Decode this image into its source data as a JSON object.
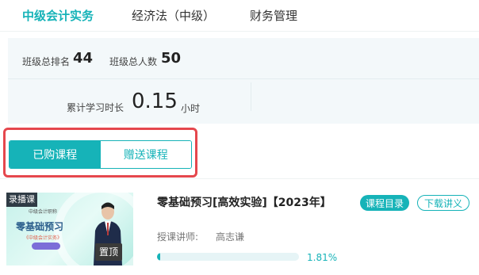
{
  "tabs": [
    {
      "label": "中级会计实务",
      "active": true
    },
    {
      "label": "经济法（中级）",
      "active": false
    },
    {
      "label": "财务管理",
      "active": false
    }
  ],
  "stats": {
    "rank_label": "班级总排名",
    "rank_value": "44",
    "total_label": "班级总人数",
    "total_value": "50",
    "time_label": "累计学习时长",
    "time_value": "0.15",
    "time_unit": "小时"
  },
  "segment": {
    "purchased_label": "已购课程",
    "gifted_label": "赠送课程",
    "active": "purchased"
  },
  "course": {
    "title": "零基础预习[高效实验]【2023年】",
    "catalog_label": "课程目录",
    "download_label": "下载讲义",
    "teacher_label": "授课讲师:",
    "teacher_name": "高志谦",
    "progress_fraction": 0.0181,
    "progress_text": "1.81%",
    "thumbnail": {
      "badge": "录播课",
      "subtitle": "中级会计职称",
      "title": "零基础预习",
      "tag": "《中级会计实务》",
      "pin_label": "置顶"
    }
  },
  "colors": {
    "accent": "#16b3b8",
    "highlight": "#e5474d",
    "panel_bg": "#f3f8fa"
  }
}
